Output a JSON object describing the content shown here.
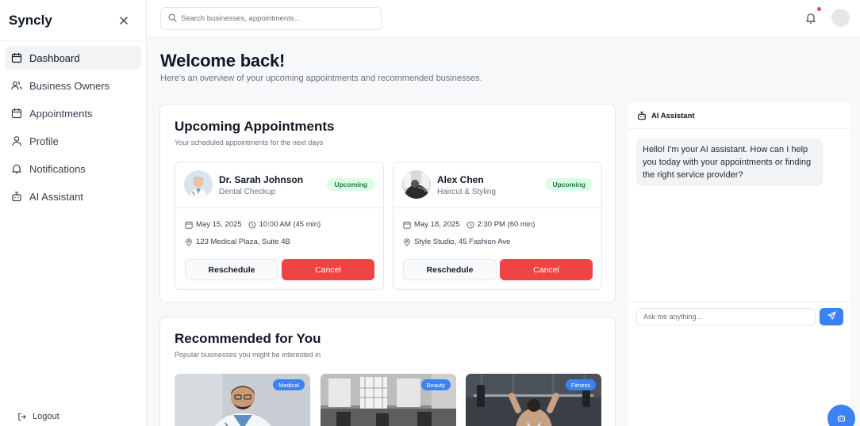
{
  "sidebar": {
    "brand": "Syncly",
    "close_icon": "close-icon",
    "items": [
      {
        "label": "Dashboard",
        "icon": "calendar-icon",
        "active": true
      },
      {
        "label": "Business Owners",
        "icon": "users-icon",
        "active": false
      },
      {
        "label": "Appointments",
        "icon": "calendar-icon",
        "active": false
      },
      {
        "label": "Profile",
        "icon": "user-icon",
        "active": false
      },
      {
        "label": "Notifications",
        "icon": "bell-icon",
        "active": false
      },
      {
        "label": "AI Assistant",
        "icon": "bot-icon",
        "active": false
      }
    ],
    "logout_label": "Logout"
  },
  "topbar": {
    "search_placeholder": "Search businesses, appointments...",
    "notification_dot_color": "#ef4444"
  },
  "welcome": {
    "title": "Welcome back!",
    "subtitle": "Here's an overview of your upcoming appointments and recommended businesses."
  },
  "upcoming": {
    "title": "Upcoming Appointments",
    "subtitle": "Your scheduled appointments for the next days",
    "appointments": [
      {
        "name": "Dr. Sarah Johnson",
        "service": "Dental Checkup",
        "status": "Upcoming",
        "date": "May 15, 2025",
        "time": "10:00 AM (45 min)",
        "location": "123 Medical Plaza, Suite 4B",
        "reschedule_label": "Reschedule",
        "cancel_label": "Cancel"
      },
      {
        "name": "Alex Chen",
        "service": "Haircut & Styling",
        "status": "Upcoming",
        "date": "May 18, 2025",
        "time": "2:30 PM (60 min)",
        "location": "Style Studio, 45 Fashion Ave",
        "reschedule_label": "Reschedule",
        "cancel_label": "Cancel"
      }
    ]
  },
  "recommended": {
    "title": "Recommended for You",
    "subtitle": "Popular businesses you might be interested in",
    "businesses": [
      {
        "category": "Medical"
      },
      {
        "category": "Beauty"
      },
      {
        "category": "Fitness"
      }
    ]
  },
  "ai_assistant": {
    "title": "AI Assistant",
    "message": "Hello! I'm your AI assistant. How can I help you today with your appointments or finding the right service provider?",
    "input_placeholder": "Ask me anything..."
  },
  "colors": {
    "accent": "#3b82f6",
    "danger": "#ef4444",
    "success_bg": "#dcfce7",
    "success_text": "#15803d"
  }
}
